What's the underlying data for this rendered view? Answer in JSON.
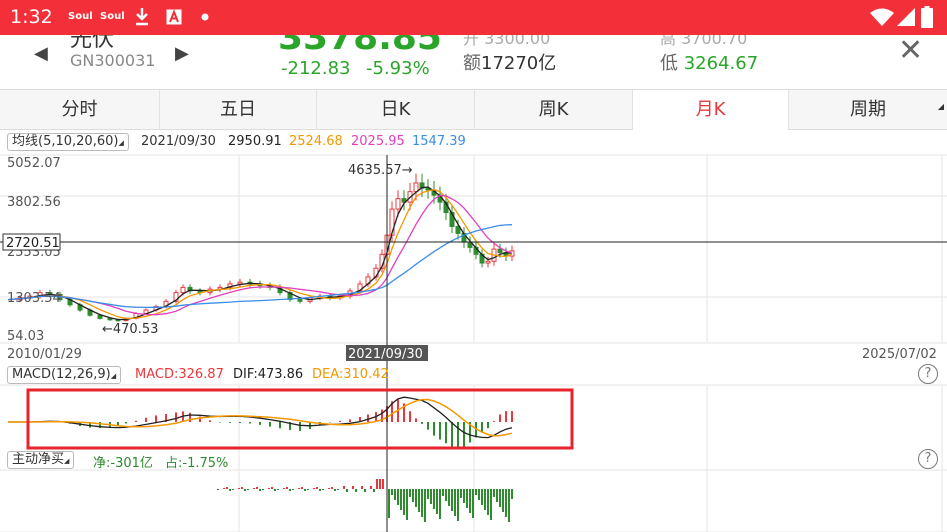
{
  "status_bar": {
    "time": "1:32",
    "app1": "Soul",
    "app2": "Soul",
    "icons": [
      "download-icon",
      "app-a-icon",
      "dot-icon",
      "wifi-icon",
      "signal-icon",
      "battery-icon"
    ]
  },
  "header": {
    "name": "光伏",
    "code": "GN300031",
    "price": "3378.85",
    "change": "-212.83",
    "change_pct": "-5.93%",
    "amount_label": "额",
    "amount_value": "17270亿",
    "low_label": "低",
    "low_value": "3264.67",
    "open_partial": "开 3300.00",
    "high_partial": "高 3700.70"
  },
  "tabs": [
    {
      "label": "分时",
      "active": false
    },
    {
      "label": "五日",
      "active": false
    },
    {
      "label": "日K",
      "active": false
    },
    {
      "label": "周K",
      "active": false
    },
    {
      "label": "月K",
      "active": true
    },
    {
      "label": "周期",
      "active": false
    }
  ],
  "ma_bar": {
    "selector": "均线(5,10,20,60)",
    "date": "2021/09/30",
    "ma5": "2950.91",
    "ma10": "2524.68",
    "ma20": "2025.95",
    "ma60": "1547.39"
  },
  "price_axis": {
    "top": "5052.07",
    "second": "3802.56",
    "crosshair_value": "2720.51",
    "third_partial": "2553.05",
    "fourth_partial": "1303.54",
    "bottom": "54.03"
  },
  "annotations": {
    "high_mark": "4635.57→",
    "low_mark": "←470.53"
  },
  "time_axis": {
    "start": "2010/01/29",
    "crosshair": "2021/09/30",
    "end": "2025/07/02"
  },
  "macd_bar": {
    "selector": "MACD(12,26,9)",
    "macd": "MACD:326.87",
    "dif": "DIF:473.86",
    "dea": "DEA:310.42"
  },
  "flow_bar": {
    "selector": "主动净买",
    "net": "净:-301亿",
    "ratio": "占:-1.75%"
  },
  "help_symbol": "?",
  "colors": {
    "up": "#e8383d",
    "down": "#2e8b2e",
    "ma5": "#222222",
    "ma10": "#f39800",
    "ma20": "#e040c0",
    "ma60": "#3a8ee6",
    "status_bar": "#f3303a",
    "highlight_box": "#e8232b"
  },
  "chart_data": [
    {
      "type": "candlestick",
      "title": "月K",
      "x_range": [
        "2010/01/29",
        "2025/07/02"
      ],
      "y_range": [
        54.03,
        5052.07
      ],
      "series": [
        {
          "name": "MA5",
          "value": 2950.91
        },
        {
          "name": "MA10",
          "value": 2524.68
        },
        {
          "name": "MA20",
          "value": 2025.95
        },
        {
          "name": "MA60",
          "value": 1547.39
        }
      ],
      "annotations": [
        {
          "label": "high",
          "value": 4635.57
        },
        {
          "label": "low",
          "value": 470.53
        }
      ]
    },
    {
      "type": "line",
      "title": "MACD(12,26,9)",
      "series": [
        {
          "name": "MACD",
          "value": 326.87
        },
        {
          "name": "DIF",
          "value": 473.86
        },
        {
          "name": "DEA",
          "value": 310.42
        }
      ]
    },
    {
      "type": "bar",
      "title": "主动净买",
      "series": [
        {
          "name": "净",
          "value": -301
        },
        {
          "name": "占",
          "value": -1.75
        }
      ]
    }
  ]
}
